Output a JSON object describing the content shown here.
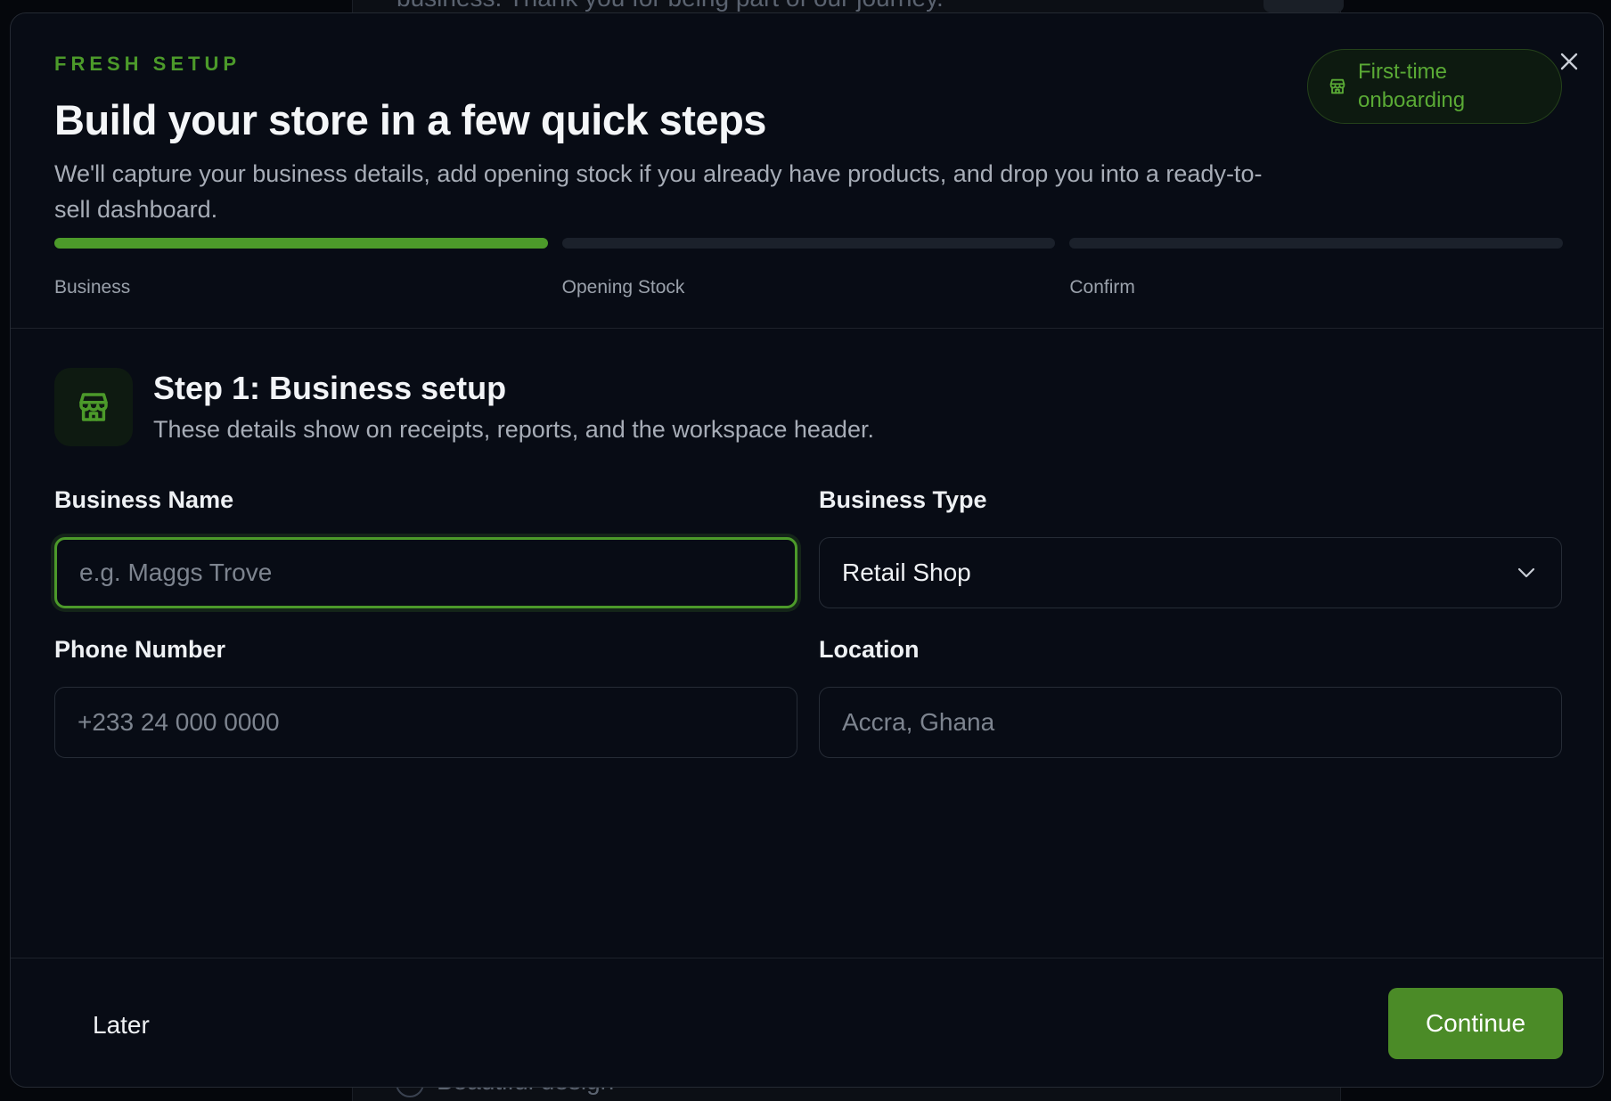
{
  "backdrop": {
    "top_text": "business. Thank you for being part of our journey.",
    "bottom_text": "Beautiful design"
  },
  "modal": {
    "eyebrow": "FRESH SETUP",
    "title": "Build your store in a few quick steps",
    "subtitle": "We'll capture your business details, add opening stock if you already have products, and drop you into a ready-to-sell dashboard.",
    "badge": {
      "icon": "store-icon",
      "label": "First-time onboarding"
    },
    "close_icon": "close-icon"
  },
  "progress": {
    "current_step": 1,
    "total_steps": 3,
    "steps": [
      {
        "label": "Business",
        "active": true
      },
      {
        "label": "Opening Stock",
        "active": false
      },
      {
        "label": "Confirm",
        "active": false
      }
    ]
  },
  "section": {
    "icon": "store-icon",
    "title": "Step 1: Business setup",
    "description": "These details show on receipts, reports, and the workspace header."
  },
  "form": {
    "business_name": {
      "label": "Business Name",
      "value": "",
      "placeholder": "e.g. Maggs Trove"
    },
    "business_type": {
      "label": "Business Type",
      "value": "Retail Shop",
      "icon": "chevron-down-icon"
    },
    "phone": {
      "label": "Phone Number",
      "value": "",
      "placeholder": "+233 24 000 0000"
    },
    "location": {
      "label": "Location",
      "value": "",
      "placeholder": "Accra, Ghana"
    }
  },
  "footer": {
    "later_label": "Later",
    "continue_label": "Continue"
  },
  "colors": {
    "accent": "#4c9a2a",
    "background": "#080c15",
    "button": "#4b8b27"
  }
}
